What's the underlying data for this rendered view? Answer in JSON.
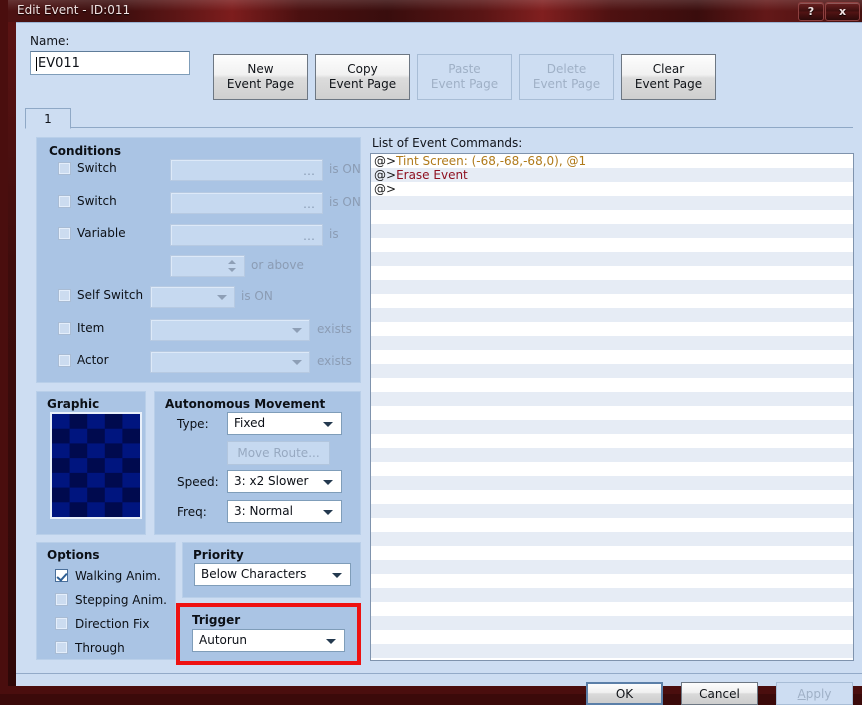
{
  "window": {
    "title": "Edit Event - ID:011",
    "help_button": "?",
    "close_button": "x"
  },
  "header": {
    "name_label": "Name:",
    "name_value": "EV011",
    "name_placeholder": "",
    "buttons": [
      {
        "line1": "New",
        "line2": "Event Page",
        "enabled": true
      },
      {
        "line1": "Copy",
        "line2": "Event Page",
        "enabled": true
      },
      {
        "line1": "Paste",
        "line2": "Event Page",
        "enabled": false
      },
      {
        "line1": "Delete",
        "line2": "Event Page",
        "enabled": false
      },
      {
        "line1": "Clear",
        "line2": "Event Page",
        "enabled": true
      }
    ]
  },
  "tabs": [
    {
      "label": "1",
      "active": true
    }
  ],
  "conditions": {
    "title": "Conditions",
    "rows": [
      {
        "label": "Switch",
        "checked": false,
        "field_value": "",
        "suffix": "is ON"
      },
      {
        "label": "Switch",
        "checked": false,
        "field_value": "",
        "suffix": "is ON"
      },
      {
        "label": "Variable",
        "checked": false,
        "field_value": "",
        "suffix": "is"
      },
      {
        "label": "",
        "checked": null,
        "field_value": "",
        "suffix": "or above"
      },
      {
        "label": "Self Switch",
        "checked": false,
        "field_value": "",
        "suffix": "is ON"
      },
      {
        "label": "Item",
        "checked": false,
        "field_value": "",
        "suffix": "exists"
      },
      {
        "label": "Actor",
        "checked": false,
        "field_value": "",
        "suffix": "exists"
      }
    ]
  },
  "graphic": {
    "title": "Graphic",
    "pattern": "checkerboard",
    "color_a": "#00157f",
    "color_b": "#000a4e",
    "cols": 5,
    "rows": 7
  },
  "movement": {
    "title": "Autonomous Movement",
    "type_label": "Type:",
    "type_value": "Fixed",
    "move_route_label": "Move Route...",
    "move_route_enabled": false,
    "speed_label": "Speed:",
    "speed_value": "3: x2 Slower",
    "freq_label": "Freq:",
    "freq_value": "3: Normal"
  },
  "options": {
    "title": "Options",
    "items": [
      {
        "label": "Walking Anim.",
        "checked": true
      },
      {
        "label": "Stepping Anim.",
        "checked": false
      },
      {
        "label": "Direction Fix",
        "checked": false
      },
      {
        "label": "Through",
        "checked": false
      }
    ]
  },
  "priority": {
    "title": "Priority",
    "value": "Below Characters"
  },
  "trigger": {
    "title": "Trigger",
    "value": "Autorun",
    "highlight_color": "#ee1111"
  },
  "commands": {
    "label": "List of Event Commands:",
    "marker": "@>",
    "items": [
      {
        "text": "Tint Screen: (-68,-68,-68,0), @1",
        "color": "#b07a1a"
      },
      {
        "text": "Erase Event",
        "color": "#8e1020"
      },
      {
        "text": "",
        "color": "#1a1a1a"
      }
    ],
    "total_rows": 36
  },
  "footer": {
    "ok_label": "OK",
    "cancel_label": "Cancel",
    "apply_label": "Apply",
    "apply_enabled": false
  }
}
